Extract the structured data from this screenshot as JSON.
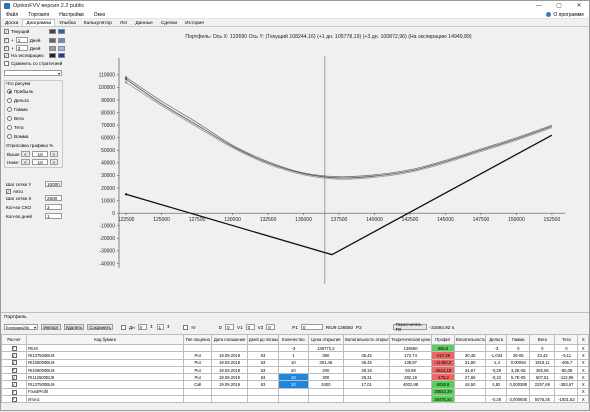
{
  "window": {
    "title": "OptionFVV версия 2.2 public"
  },
  "window_controls": {
    "minimize": "—",
    "maximize": "▢",
    "close": "✕"
  },
  "menu": [
    "Файл",
    "Торговля",
    "Настройки",
    "Окно"
  ],
  "about_label": "О программе",
  "tabs": [
    "Доска",
    "Диаграмма",
    "Улыбка",
    "Калькулятор",
    "Лог",
    "Данные",
    "Сделки",
    "История"
  ],
  "active_tab": 1,
  "left": {
    "current_label": "Текущий",
    "plus1_value": "1",
    "plus1_unit": "Дней",
    "plus3_value": "3",
    "plus3_unit": "Дней",
    "expiry_label": "На экспирацию",
    "compare_label": "Сравнить со стратегией",
    "compare_select": "",
    "what_to_draw": "Что рисуем",
    "radios": [
      "Прибыль",
      "Дельта",
      "Гамма",
      "Вега",
      "Тета",
      "Вомма"
    ],
    "selected_radio": 0,
    "cut_label": "Отрисовка графика %",
    "above_label": "Выше",
    "above_value": "10",
    "below_label": "Ниже",
    "below_value": "10",
    "grid_y_label": "Шаг сетки Y",
    "grid_y_value": "10000",
    "auto_label": "Авто",
    "grid_x_label": "Шаг сетки X",
    "grid_x_value": "2500",
    "qty_label": "Кол-во СКО",
    "qty_value": "3",
    "days_label": "Кол-во дней",
    "days_value": "1",
    "decrement": "<",
    "increment": ">"
  },
  "chart_header": {
    "portfolio": "Портфель: Ось X: 122690",
    "axis_y": "Ось Y:",
    "current": "(Текущий 108244,16)",
    "plus1": "(+1 дн. 105778,19)",
    "plus3": "(+3 дн. 100872,96)",
    "expiry": "(На экспирацию 14949,89)"
  },
  "chart_data": {
    "type": "line",
    "x_ticks": [
      122500,
      125000,
      127500,
      130000,
      132500,
      135000,
      137500,
      140000,
      142500,
      145000,
      147500,
      150000,
      152500
    ],
    "y_ticks": [
      110000,
      100000,
      90000,
      80000,
      70000,
      60000,
      50000,
      40000,
      30000,
      20000,
      10000,
      0,
      -10000,
      -20000,
      -30000,
      -40000
    ],
    "xlim": [
      122000,
      153000
    ],
    "ylim": [
      -42000,
      117000
    ],
    "cursor_x": 136500,
    "series": [
      {
        "color": "#777777",
        "x": [
          122500,
          125000,
          127500,
          130000,
          132500,
          135000,
          137500,
          140000,
          142500,
          145000,
          147500,
          150000,
          152500
        ],
        "y": [
          108000,
          89000,
          72000,
          54000,
          41000,
          32000,
          29000,
          30500,
          34500,
          42000,
          51000,
          60000,
          70000
        ]
      },
      {
        "color": "#555555",
        "x": [
          122500,
          125000,
          127500,
          130000,
          132500,
          135000,
          137500,
          140000,
          142500,
          145000,
          147500,
          150000,
          152500
        ],
        "y": [
          106500,
          87000,
          70000,
          53000,
          40000,
          31500,
          28000,
          29500,
          33500,
          41000,
          50000,
          59000,
          69000
        ]
      },
      {
        "color": "#999999",
        "x": [
          122500,
          125000,
          127500,
          130000,
          132500,
          135000,
          137500,
          140000,
          142500,
          145000,
          147500,
          150000,
          152500
        ],
        "y": [
          104000,
          85500,
          68500,
          52000,
          39000,
          30500,
          27000,
          28500,
          32500,
          40000,
          49000,
          58000,
          68000
        ]
      },
      {
        "color": "#111111",
        "x": [
          122500,
          137000,
          152500
        ],
        "y": [
          15000,
          -33000,
          62000
        ]
      }
    ]
  },
  "portfolio": {
    "label": "Портфель",
    "select_value": "Бэтформ25k",
    "import_label": "Импорт",
    "delete_label": "Удалить",
    "save_label": "Сохранить",
    "days_label": "Дн",
    "days_a": "0",
    "days_b": "1",
    "iv_label": "IV",
    "d_label": "D",
    "d_value": "0",
    "v1_label": "V1",
    "v1_value": "0",
    "v2_label": "V2",
    "v2_value": "0",
    "p1_label": "P1",
    "p1_value": "0",
    "ticker_label": "RIU9 136550",
    "p2_label": "P2",
    "recalc_label": "Пересчитать ГО",
    "go_value": "-31684.92 п.",
    "columns": [
      "Расчет",
      "Код бумаги",
      "Тип опциона",
      "Дата погашения",
      "Дней до погашения",
      "Количество",
      "Цена открытия",
      "Волатильность открытия",
      "Теоретическая цена",
      "Профит",
      "Волатильность",
      "Дельта",
      "Гамма",
      "Вега",
      "Тета",
      "X"
    ],
    "rows": [
      {
        "code": "RIU9",
        "type": "",
        "date": "",
        "days": "",
        "qty": "-3",
        "price": "136772,2",
        "vol_open": "",
        "theo": "136550",
        "profit": "666,6",
        "vol": "",
        "delta": "-3",
        "gamma": "0",
        "vega": "0",
        "theta": "0",
        "x": "X",
        "qty_hl": false,
        "profit_color": "green"
      },
      {
        "code": "RI137500BU9",
        "type": "Put",
        "date": "19.09.2019",
        "days": "63",
        "qty": "1",
        "price": "390",
        "vol_open": "35,45",
        "theo": "172,74",
        "profit": "-217,26",
        "vol": "30,45",
        "delta": "-1,033",
        "gamma": "36-06",
        "vega": "33,42",
        "theta": "-9,11",
        "x": "X",
        "qty_hl": false,
        "profit_color": "red"
      },
      {
        "code": "RI105000BU9",
        "type": "Put",
        "date": "19.09.2019",
        "days": "63",
        "qty": "10",
        "price": "301,45",
        "vol_open": "36,45",
        "theo": "138,97",
        "profit": "-11450,3",
        "vol": "31,80",
        "delta": "-1,4",
        "gamma": "0,00094",
        "vega": "1919,11",
        "theta": "-406,7",
        "x": "X",
        "qty_hl": false,
        "profit_color": "red"
      },
      {
        "code": "RI106000BU9",
        "type": "Put",
        "date": "19.09.2019",
        "days": "63",
        "qty": "20",
        "price": "200",
        "vol_open": "39,16",
        "theo": "93,98",
        "profit": "-2514,19",
        "vol": "34,67",
        "delta": "-0,29",
        "gamma": "3,2E-05",
        "vega": "392,55",
        "theta": "-85,08",
        "x": "X",
        "qty_hl": false,
        "profit_color": "red"
      },
      {
        "code": "RI112500BU9",
        "type": "Put",
        "date": "19.09.2019",
        "days": "63",
        "qty": "10",
        "price": "300",
        "vol_open": "28,31",
        "theo": "282,19",
        "profit": "-178,2",
        "vol": "27,66",
        "delta": "-0,42",
        "gamma": "5,7E-05",
        "vega": "507,51",
        "theta": "-112,86",
        "x": "X",
        "qty_hl": true,
        "profit_color": "red"
      },
      {
        "code": "RI137500BU9",
        "type": "Call",
        "date": "19.09.2019",
        "days": "63",
        "qty": "10",
        "price": "3400",
        "vol_open": "17,01",
        "theo": "4002,88",
        "profit": "6028,8",
        "vol": "18,50",
        "delta": "4,82",
        "gamma": "0,000388",
        "vega": "2257,69",
        "theta": "-353,67",
        "x": "X",
        "qty_hl": true,
        "profit_color": "green"
      },
      {
        "code": "FixedProfit",
        "type": "",
        "date": "",
        "days": "",
        "qty": "",
        "price": "",
        "vol_open": "",
        "theo": "",
        "profit": "35553,39",
        "vol": "",
        "delta": "",
        "gamma": "",
        "vega": "",
        "theta": "",
        "x": "X",
        "qty_hl": false,
        "profit_color": "green"
      },
      {
        "code": "Итого:",
        "type": "",
        "date": "",
        "days": "",
        "qty": "",
        "price": "",
        "vol_open": "",
        "theo": "",
        "profit": "28476,34",
        "vol": "",
        "delta": "-0,28",
        "gamma": "0,000936",
        "vega": "5076,25",
        "theta": "-1001,52",
        "x": "X",
        "qty_hl": false,
        "profit_color": "green"
      }
    ]
  },
  "colors": {
    "current_swatch": "#333333",
    "plus1_swatch": "#5b8fd6",
    "plus3_swatch": "#9ab7e3",
    "expiry_swatch": "#222222"
  }
}
